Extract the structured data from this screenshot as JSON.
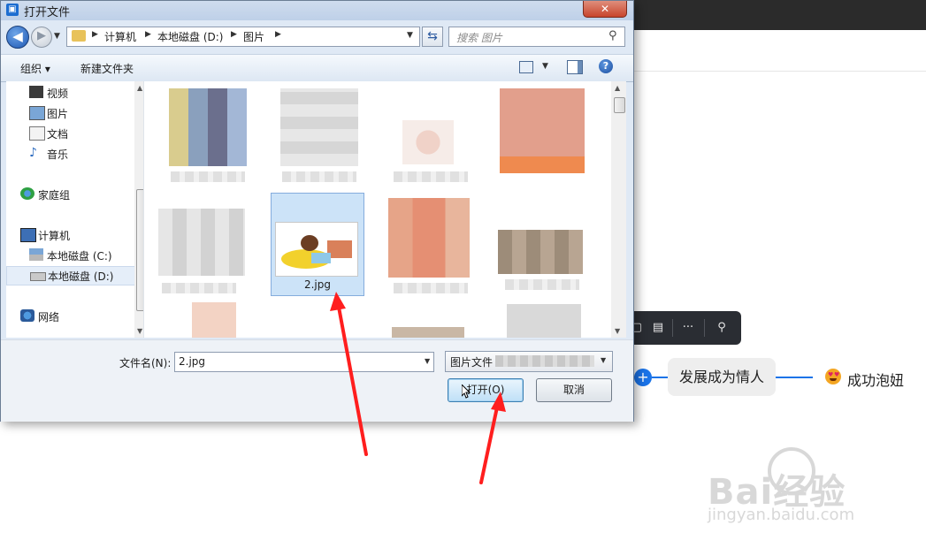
{
  "dialog": {
    "title": "打开文件",
    "close_label": "✕",
    "breadcrumb": [
      "计算机",
      "本地磁盘 (D:)",
      "图片"
    ],
    "search_placeholder": "搜索 图片",
    "toolbar": {
      "organize_label": "组织 ▾",
      "new_folder_label": "新建文件夹"
    },
    "nav_items": [
      {
        "label": "视频",
        "icon": "video-icon"
      },
      {
        "label": "图片",
        "icon": "picture-icon"
      },
      {
        "label": "文档",
        "icon": "document-icon"
      },
      {
        "label": "音乐",
        "icon": "music-icon"
      },
      {
        "label": "家庭组",
        "icon": "homegroup-icon"
      },
      {
        "label": "计算机",
        "icon": "computer-icon"
      },
      {
        "label": "本地磁盘 (C:)",
        "icon": "drive-c-icon"
      },
      {
        "label": "本地磁盘 (D:)",
        "icon": "drive-d-icon",
        "selected": true
      },
      {
        "label": "网络",
        "icon": "network-icon"
      }
    ],
    "files": [
      {
        "name": "",
        "selected": false
      },
      {
        "name": "",
        "selected": false
      },
      {
        "name": "",
        "selected": false
      },
      {
        "name": "",
        "selected": false
      },
      {
        "name": "",
        "selected": false
      },
      {
        "name": "2.jpg",
        "selected": true
      },
      {
        "name": "",
        "selected": false
      },
      {
        "name": "",
        "selected": false
      }
    ],
    "filename_label": "文件名(N):",
    "filename_value": "2.jpg",
    "filetype_value": "图片文件",
    "open_button": "打开(O)",
    "cancel_button": "取消"
  },
  "background": {
    "mindmap_node": "发展成为情人",
    "mindmap_child": "成功泡妞",
    "toolbar_more": "···",
    "watermark_main": "Bai经验",
    "watermark_url": "jingyan.baidu.com"
  },
  "colors": {
    "accent": "#1a73e8",
    "dialog_bg": "#dfe9f5",
    "selection": "#cce3f8",
    "annotation_arrow": "#ff1e1e"
  }
}
